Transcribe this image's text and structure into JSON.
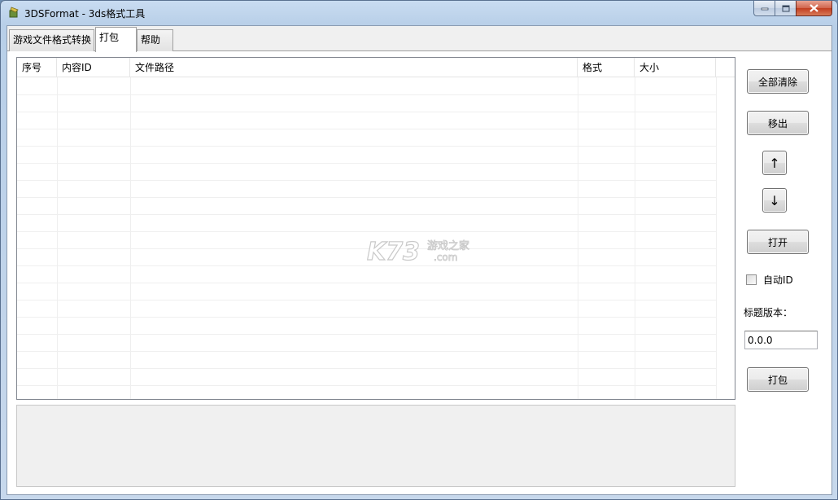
{
  "window": {
    "title": "3DSFormat - 3ds格式工具",
    "min_label": "▬",
    "max_label": "□",
    "close_label": "✕"
  },
  "tabs": [
    {
      "label": "游戏文件格式转换",
      "active": false
    },
    {
      "label": "打包",
      "active": true
    },
    {
      "label": "帮助",
      "active": false
    }
  ],
  "list": {
    "columns": [
      "序号",
      "内容ID",
      "文件路径",
      "格式",
      "大小"
    ],
    "rows": []
  },
  "watermark": {
    "brand": "K73",
    "site": "游戏之家",
    "domain": ".com"
  },
  "actions": {
    "clear_all": "全部清除",
    "remove": "移出",
    "move_up": "↑",
    "move_down": "↓",
    "open": "打开",
    "pack": "打包"
  },
  "options": {
    "auto_id_label": "自动ID",
    "auto_id_checked": false,
    "title_version_label": "标题版本：",
    "title_version_value": "0.0.0"
  },
  "log": {
    "text": ""
  }
}
